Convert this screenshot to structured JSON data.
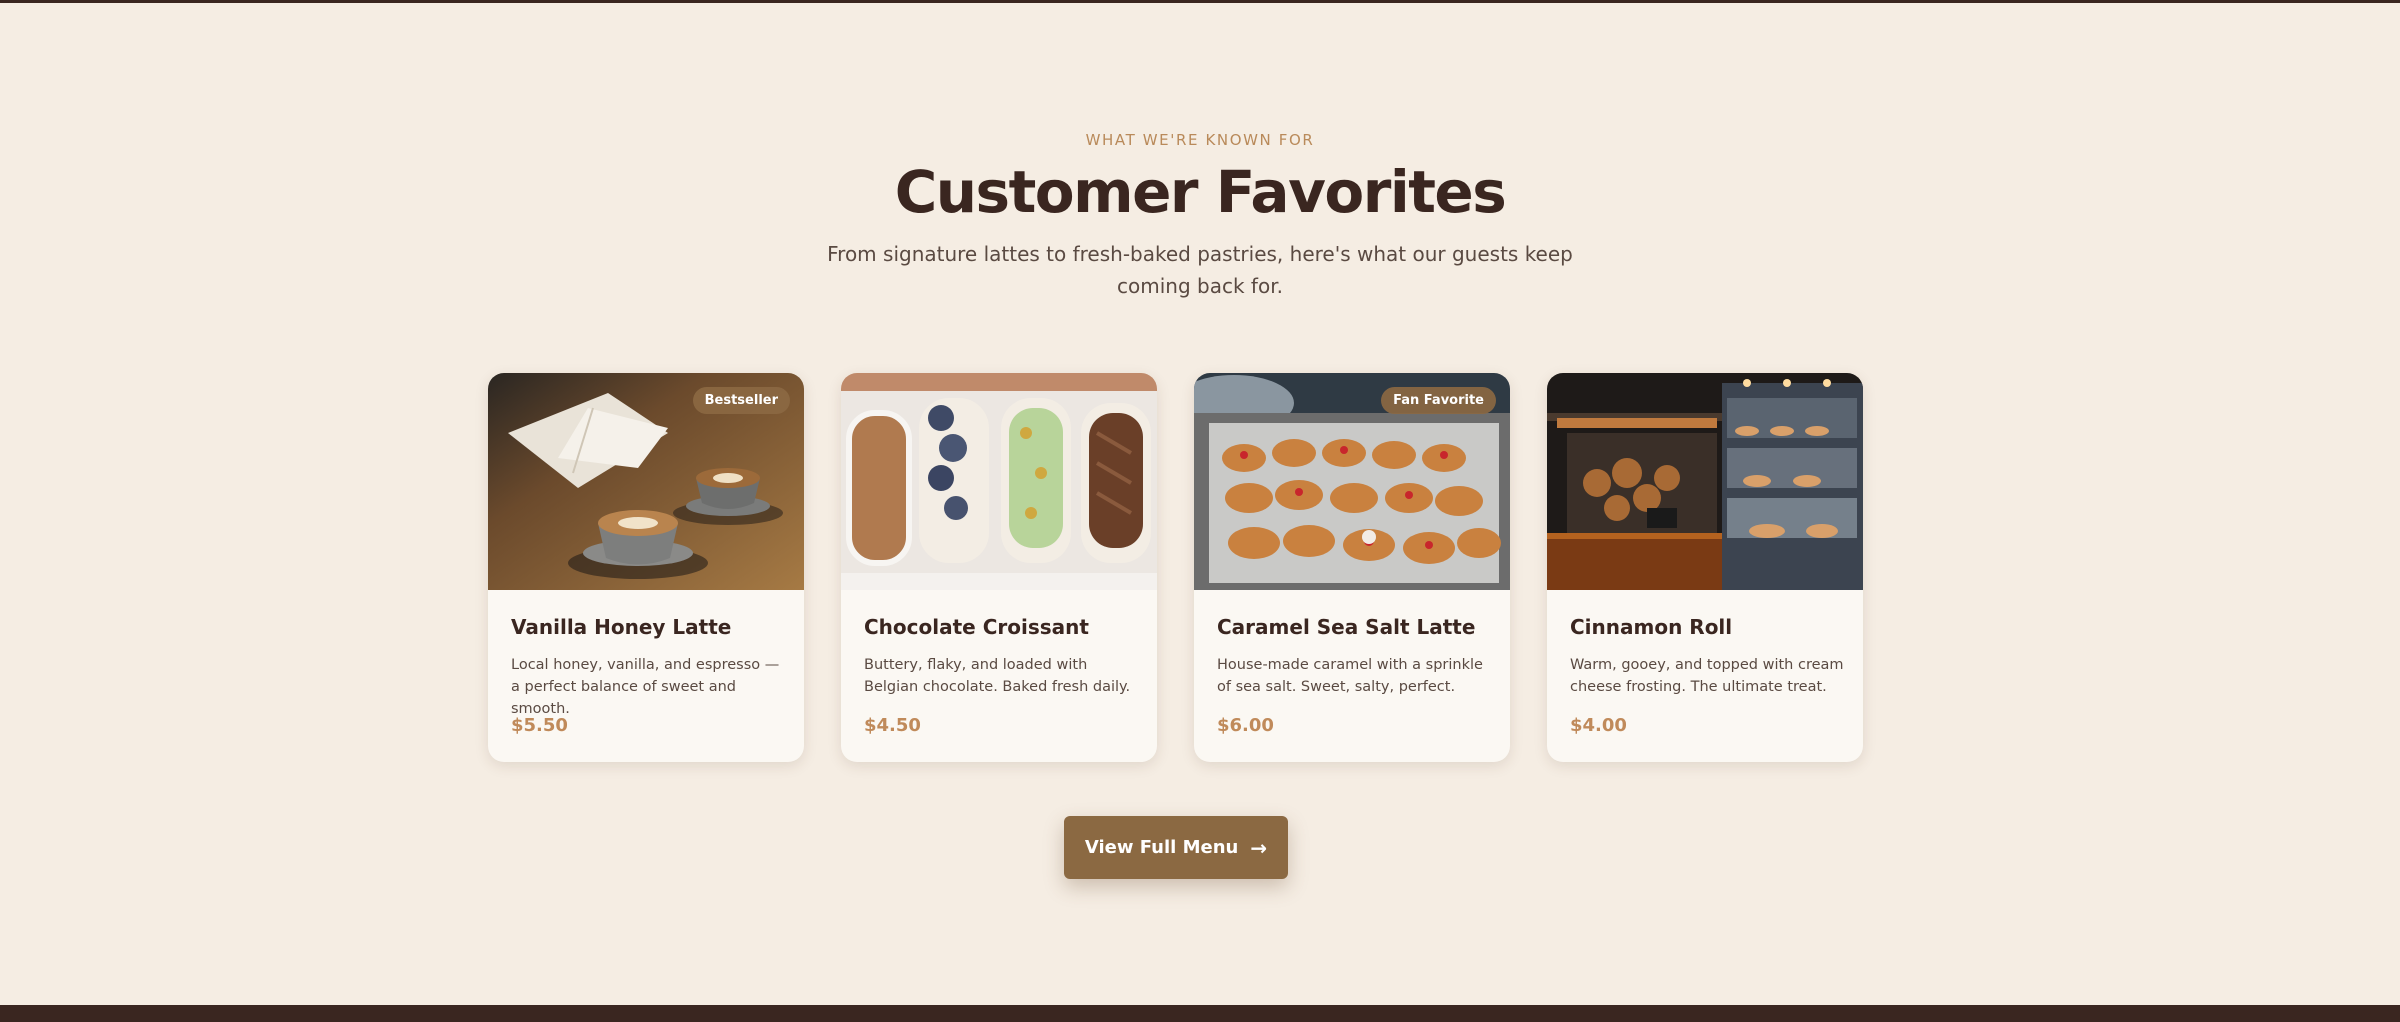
{
  "section": {
    "eyebrow": "WHAT WE'RE KNOWN FOR",
    "title": "Customer Favorites",
    "subtitle": "From signature lattes to fresh-baked pastries, here's what our guests keep coming back for."
  },
  "cards": [
    {
      "badge": "Bestseller",
      "title": "Vanilla Honey Latte",
      "description": "Local honey, vanilla, and espresso — a perfect balance of sweet and smooth.",
      "price": "$5.50",
      "image_icon": "latte-photo"
    },
    {
      "badge": "",
      "title": "Chocolate Croissant",
      "description": "Buttery, flaky, and loaded with Belgian chocolate. Baked fresh daily.",
      "price": "$4.50",
      "image_icon": "eclair-photo"
    },
    {
      "badge": "Fan Favorite",
      "title": "Caramel Sea Salt Latte",
      "description": "House-made caramel with a sprinkle of sea salt. Sweet, salty, perfect.",
      "price": "$6.00",
      "image_icon": "pastry-tray-photo"
    },
    {
      "badge": "",
      "title": "Cinnamon Roll",
      "description": "Warm, gooey, and topped with cream cheese frosting. The ultimate treat.",
      "price": "$4.00",
      "image_icon": "bakery-case-photo"
    }
  ],
  "cta": {
    "label": "View Full Menu",
    "icon": "arrow-right-icon"
  },
  "colors": {
    "background": "#f5ede3",
    "heading": "#3a2620",
    "accent": "#8b6942",
    "price": "#c08a5a",
    "eyebrow": "#b98a5a"
  }
}
